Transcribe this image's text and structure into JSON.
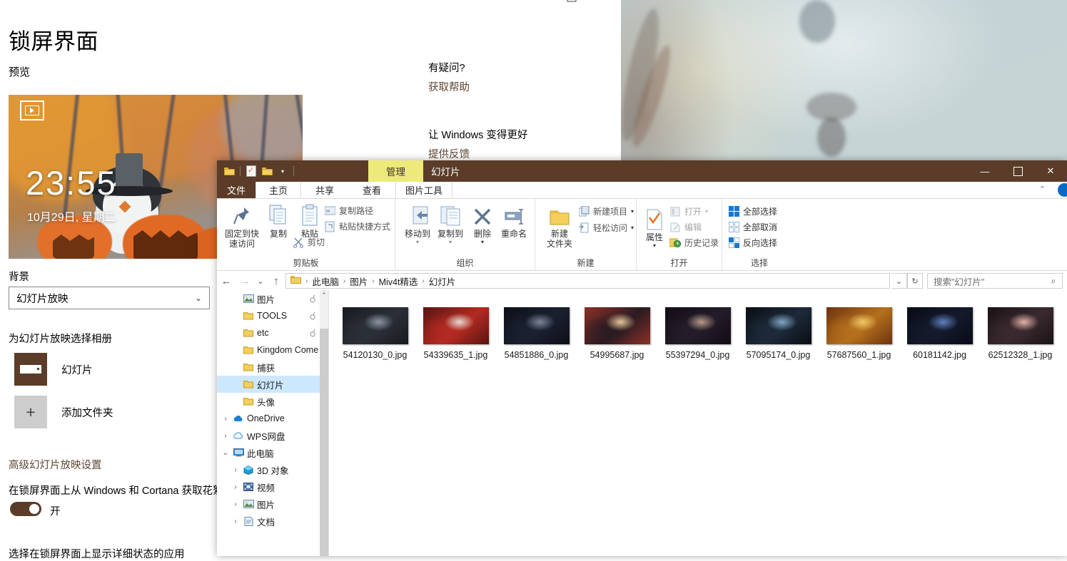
{
  "settings": {
    "window_controls": {
      "maximize": "□",
      "close": "✕"
    },
    "title": "锁屏界面",
    "preview_label": "预览",
    "preview": {
      "badge_icon": "slideshow-play-icon",
      "time": "23:55",
      "date": "10月29日, 星期二"
    },
    "background_label": "背景",
    "background_value": "幻灯片放映",
    "background_chevron": "⌄",
    "album_section_label": "为幻灯片放映选择相册",
    "albums": [
      {
        "label": "幻灯片",
        "icon": "folder-thumbnail"
      },
      {
        "label": "添加文件夹",
        "icon": "plus-icon"
      }
    ],
    "advanced_link": "高级幻灯片放映设置",
    "cortana_label": "在锁屏界面上从 Windows 和 Cortana 获取花絮",
    "toggle_state": "开",
    "apps_label": "选择在锁屏界面上显示详细状态的应用",
    "right_column": {
      "question_heading": "有疑问?",
      "help_link": "获取帮助",
      "improve_heading": "让 Windows 变得更好",
      "feedback_link": "提供反馈"
    }
  },
  "explorer": {
    "quick_access": [
      {
        "name": "folder-icon"
      },
      {
        "name": "properties-icon"
      },
      {
        "name": "new-folder-icon"
      },
      {
        "name": "customize-caret-icon",
        "glyph": "▾"
      }
    ],
    "contextual_tab": "管理",
    "window_title": "幻灯片",
    "window_buttons": {
      "minimize": "—",
      "maximize": "□",
      "close": "✕"
    },
    "tabs": [
      {
        "label": "文件",
        "name": "tab-file"
      },
      {
        "label": "主页",
        "name": "tab-home"
      },
      {
        "label": "共享",
        "name": "tab-share"
      },
      {
        "label": "查看",
        "name": "tab-view"
      },
      {
        "label": "图片工具",
        "name": "tab-picture-tools"
      }
    ],
    "ribbon_collapse_icon": "⌃",
    "help_icon": "help-circle-icon",
    "ribbon_groups": [
      {
        "name": "剪贴板",
        "big_buttons": [
          {
            "label": "固定到快\n速访问",
            "line1": "固定到快",
            "line2": "速访问",
            "icon": "pin-icon"
          },
          {
            "label": "复制",
            "icon": "copy-icon"
          },
          {
            "label": "粘贴",
            "icon": "paste-icon"
          }
        ],
        "small_buttons": [
          {
            "label": "复制路径",
            "icon": "copy-path-icon"
          },
          {
            "label": "粘贴快捷方式",
            "icon": "paste-shortcut-icon"
          },
          {
            "label": "剪切",
            "icon": "scissors-icon"
          }
        ]
      },
      {
        "name": "组织",
        "big_buttons": [
          {
            "label": "移动到",
            "icon": "move-to-icon"
          },
          {
            "label": "复制到",
            "icon": "copy-to-icon"
          },
          {
            "label": "删除",
            "icon": "delete-x-icon"
          },
          {
            "label": "重命名",
            "icon": "rename-icon"
          }
        ],
        "small_buttons": []
      },
      {
        "name": "新建",
        "big_buttons": [
          {
            "label": "新建\n文件夹",
            "line1": "新建",
            "line2": "文件夹",
            "icon": "new-folder-icon"
          }
        ],
        "small_buttons": [
          {
            "label": "新建项目",
            "icon": "new-item-icon",
            "caret": "▾"
          },
          {
            "label": "轻松访问",
            "icon": "easy-access-icon",
            "caret": "▾"
          }
        ]
      },
      {
        "name": "打开",
        "big_buttons": [
          {
            "label": "属性",
            "icon": "properties-icon"
          }
        ],
        "small_buttons": [
          {
            "label": "打开",
            "icon": "open-icon",
            "caret": "▾"
          },
          {
            "label": "编辑",
            "icon": "edit-icon"
          },
          {
            "label": "历史记录",
            "icon": "history-icon"
          }
        ]
      },
      {
        "name": "选择",
        "big_buttons": [],
        "small_buttons": [
          {
            "label": "全部选择",
            "icon": "select-all-icon"
          },
          {
            "label": "全部取消",
            "icon": "select-none-icon"
          },
          {
            "label": "反向选择",
            "icon": "invert-selection-icon"
          }
        ]
      }
    ],
    "address": {
      "back_icon": "←",
      "forward_icon": "→",
      "recent_icon": "⌄",
      "up_icon": "↑",
      "breadcrumb": [
        "此电脑",
        "图片",
        "Miv4t精选",
        "幻灯片"
      ],
      "separator": "›",
      "history_chevron": "⌄",
      "refresh_icon": "↻",
      "search_placeholder": "搜索\"幻灯片\"",
      "search_icon": "⌕"
    },
    "nav_tree": [
      {
        "label": "图片",
        "icon": "pictures-icon",
        "indent": 1,
        "pinned": true,
        "expander": ""
      },
      {
        "label": "TOOLS",
        "icon": "folder-icon",
        "indent": 1,
        "pinned": true,
        "expander": ""
      },
      {
        "label": "etc",
        "icon": "folder-icon",
        "indent": 1,
        "pinned": true,
        "expander": ""
      },
      {
        "label": "Kingdom Come",
        "icon": "folder-icon",
        "indent": 1,
        "pinned": false,
        "expander": ""
      },
      {
        "label": "捕获",
        "icon": "folder-icon",
        "indent": 1,
        "pinned": false,
        "expander": ""
      },
      {
        "label": "幻灯片",
        "icon": "folder-icon",
        "indent": 1,
        "pinned": false,
        "expander": "",
        "selected": true
      },
      {
        "label": "头像",
        "icon": "folder-icon",
        "indent": 1,
        "pinned": false,
        "expander": ""
      },
      {
        "label": "OneDrive",
        "icon": "onedrive-icon",
        "indent": 0,
        "pinned": false,
        "expander": "›"
      },
      {
        "label": "WPS网盘",
        "icon": "wps-cloud-icon",
        "indent": 0,
        "pinned": false,
        "expander": "›"
      },
      {
        "label": "此电脑",
        "icon": "this-pc-icon",
        "indent": 0,
        "pinned": false,
        "expander": "⌄"
      },
      {
        "label": "3D 对象",
        "icon": "3d-objects-icon",
        "indent": 1,
        "pinned": false,
        "expander": "›"
      },
      {
        "label": "视频",
        "icon": "videos-icon",
        "indent": 1,
        "pinned": false,
        "expander": "›"
      },
      {
        "label": "图片",
        "icon": "pictures-icon",
        "indent": 1,
        "pinned": false,
        "expander": "›"
      },
      {
        "label": "文档",
        "icon": "documents-icon",
        "indent": 1,
        "pinned": false,
        "expander": "›"
      }
    ],
    "files": [
      {
        "name": "54120130_0.jpg",
        "c1": "#2b3038",
        "c2": "#8e94a4",
        "c3": "#171a20"
      },
      {
        "name": "54339635_1.jpg",
        "c1": "#b32a22",
        "c2": "#e8dcd2",
        "c3": "#5a1512"
      },
      {
        "name": "54851886_0.jpg",
        "c1": "#1b2030",
        "c2": "#7b8598",
        "c3": "#0d1018"
      },
      {
        "name": "54995687.jpg",
        "c1": "#2a1b22",
        "c2": "#e6c79a",
        "c3": "#8d3026"
      },
      {
        "name": "55397294_0.jpg",
        "c1": "#241c2a",
        "c2": "#b79a86",
        "c3": "#120d16"
      },
      {
        "name": "57095174_0.jpg",
        "c1": "#1d2a3a",
        "c2": "#7fa6c4",
        "c3": "#0a0e14"
      },
      {
        "name": "57687560_1.jpg",
        "c1": "#b5701c",
        "c2": "#f0c96a",
        "c3": "#6d3310"
      },
      {
        "name": "60181142.jpg",
        "c1": "#141a2c",
        "c2": "#5f7fc0",
        "c3": "#090c16"
      },
      {
        "name": "62512328_1.jpg",
        "c1": "#3a2a30",
        "c2": "#e0b2a6",
        "c3": "#1a1216"
      }
    ]
  }
}
